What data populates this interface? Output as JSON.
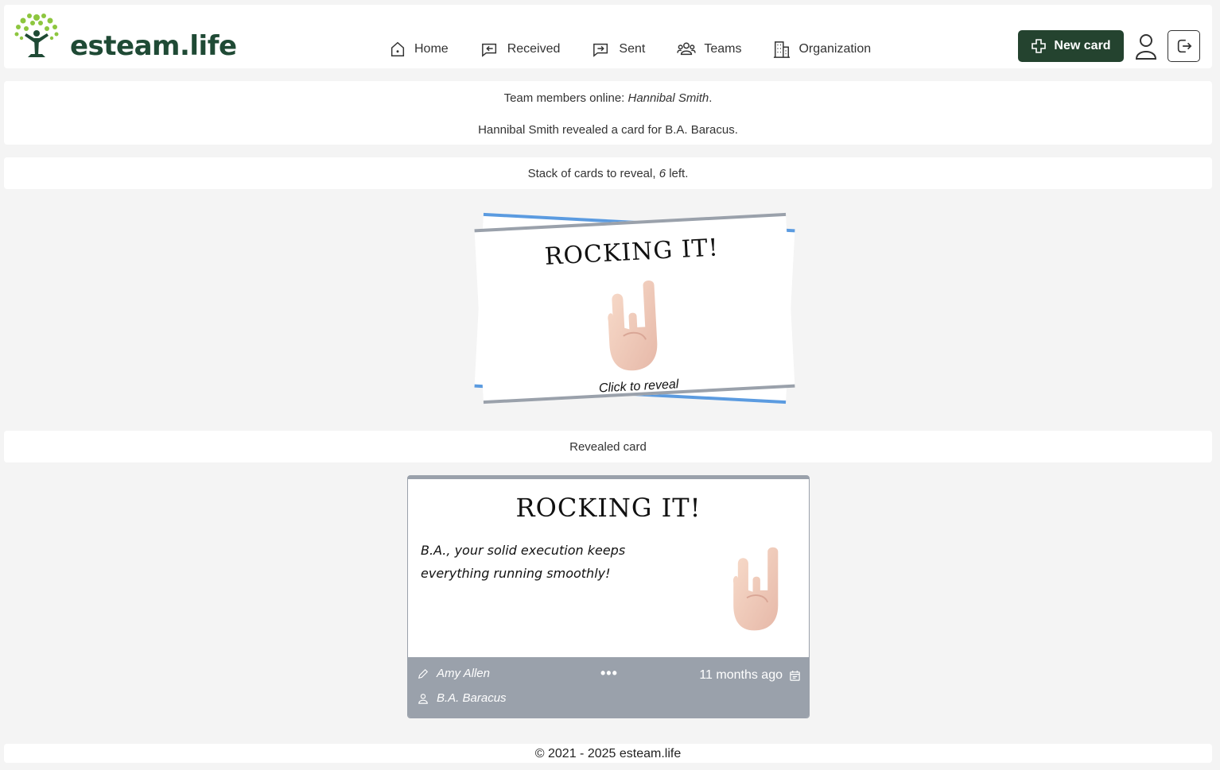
{
  "header": {
    "brand": "esteam.life",
    "nav": [
      {
        "label": "Home",
        "icon": "home-icon"
      },
      {
        "label": "Received",
        "icon": "received-icon"
      },
      {
        "label": "Sent",
        "icon": "sent-icon"
      },
      {
        "label": "Teams",
        "icon": "teams-icon"
      },
      {
        "label": "Organization",
        "icon": "organization-icon"
      }
    ],
    "new_card_label": "New card",
    "brand_color": "#24432f"
  },
  "activity": {
    "online_prefix": "Team members online: ",
    "online_names": "Hannibal Smith",
    "online_suffix": ".",
    "event": "Hannibal Smith revealed a card for B.A. Baracus."
  },
  "stack": {
    "prefix": "Stack of cards to reveal, ",
    "count": "6",
    "suffix": " left.",
    "card_title": "ROCKING IT!",
    "click_label": "Click to reveal"
  },
  "revealed": {
    "heading": "Revealed card",
    "card_title": "ROCKING IT!",
    "message": "B.A., your solid execution keeps everything running smoothly!",
    "author": "Amy Allen",
    "recipient": "B.A. Baracus",
    "more": "•••",
    "time": "11 months ago"
  },
  "footer": {
    "text": "© 2021 - 2025  esteam.life"
  }
}
